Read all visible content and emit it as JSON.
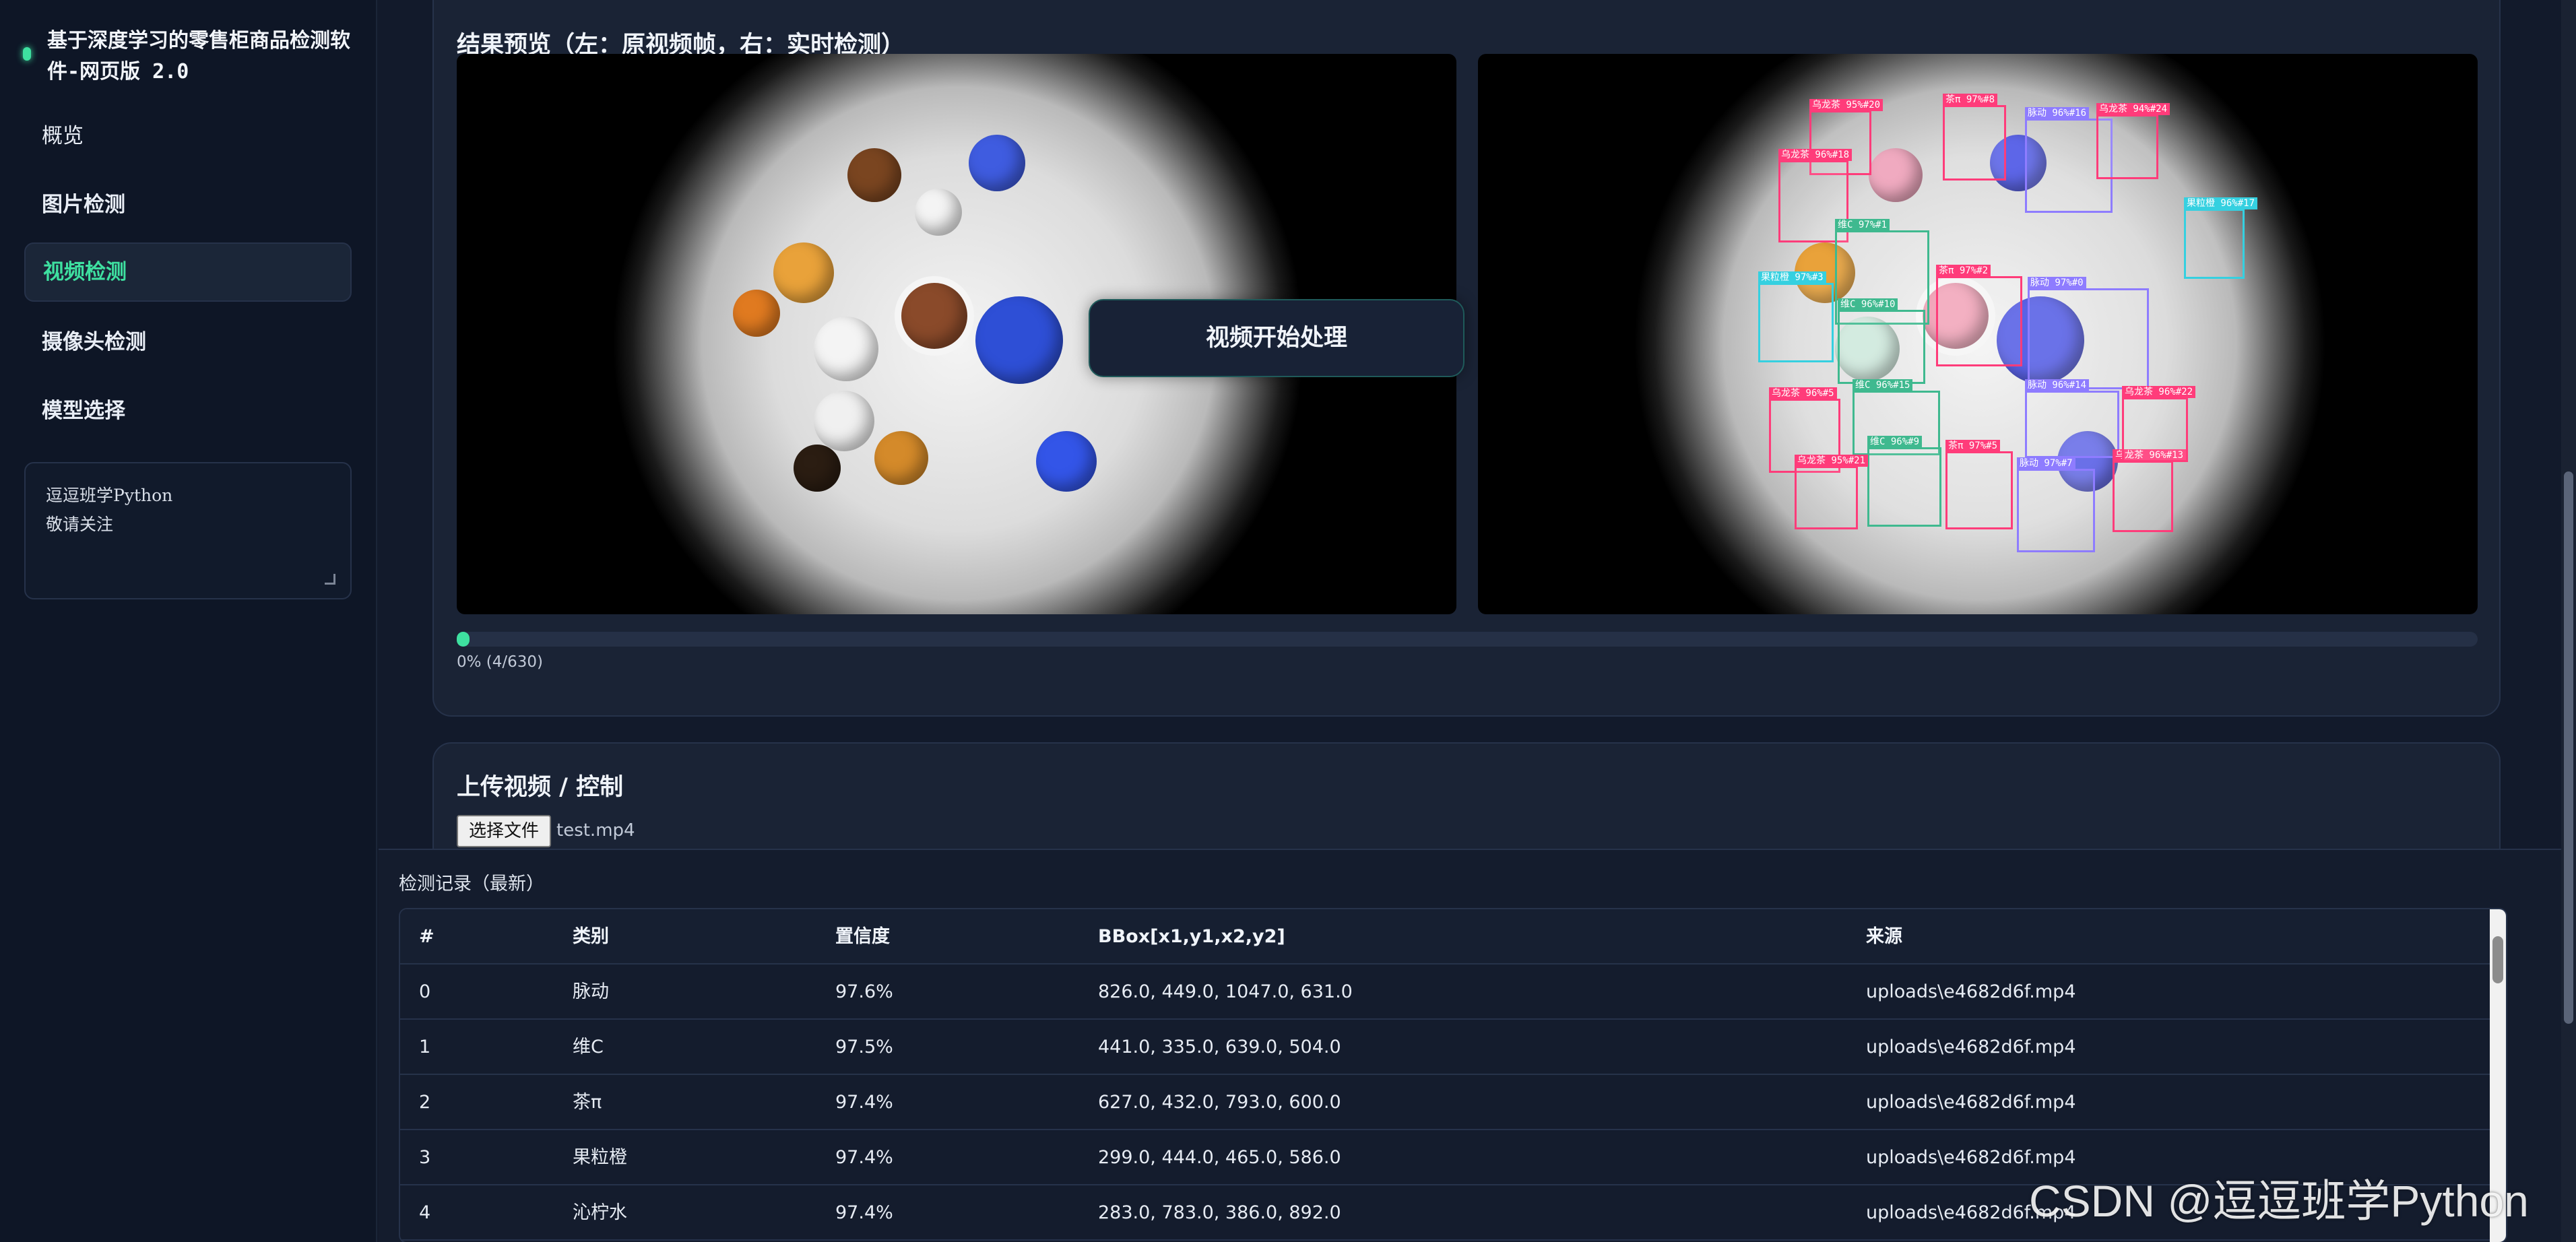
{
  "sidebar": {
    "brand_title": "基于深度学习的零售柜商品检测软件-网页版 2.0",
    "items": [
      {
        "label": "概览"
      },
      {
        "label": "图片检测"
      },
      {
        "label": "视频检测"
      },
      {
        "label": "摄像头检测"
      },
      {
        "label": "模型选择"
      }
    ],
    "active_item": "视频检测",
    "notes_text": "逗逗班学Python\n敬请关注"
  },
  "preview": {
    "title": "结果预览（左：原视频帧，右：实时检测）",
    "toast": "视频开始处理",
    "progress_value": 0.0063,
    "progress_text": "0% (4/630)",
    "detections": [
      {
        "label": "乌龙茶 95%#20",
        "color": "#ff3c7a"
      },
      {
        "label": "茶π 97%#8",
        "color": "#ff3c7a"
      },
      {
        "label": "脉动 96%#16",
        "color": "#8e7cff"
      },
      {
        "label": "乌龙茶 94%#24",
        "color": "#ff3c7a"
      },
      {
        "label": "乌龙茶 96%#18",
        "color": "#ff3c7a"
      },
      {
        "label": "果粒橙 96%#17",
        "color": "#35d0e0"
      },
      {
        "label": "维C 97%#1",
        "color": "#3fb98f"
      },
      {
        "label": "果粒橙 97%#3",
        "color": "#35d0e0"
      },
      {
        "label": "茶π 97%#2",
        "color": "#ff3c7a"
      },
      {
        "label": "脉动 97%#0",
        "color": "#8e7cff"
      },
      {
        "label": "维C 96%#10",
        "color": "#3fb98f"
      },
      {
        "label": "维C 96%#15",
        "color": "#3fb98f"
      },
      {
        "label": "脉动 96%#14",
        "color": "#8e7cff"
      },
      {
        "label": "乌龙茶 96%#5",
        "color": "#ff3c7a"
      },
      {
        "label": "维C 96%#9",
        "color": "#3fb98f"
      },
      {
        "label": "茶π 97%#5",
        "color": "#ff3c7a"
      },
      {
        "label": "乌龙茶 95%#21",
        "color": "#ff3c7a"
      },
      {
        "label": "脉动 97%#7",
        "color": "#8e7cff"
      },
      {
        "label": "乌龙茶 96%#13",
        "color": "#ff3c7a"
      },
      {
        "label": "乌龙茶 96%#22",
        "color": "#ff3c7a"
      }
    ]
  },
  "upload": {
    "title": "上传视频 / 控制",
    "file_button": "选择文件",
    "file_name": "test.mp4"
  },
  "records": {
    "title": "检测记录（最新）",
    "headers": [
      "#",
      "类别",
      "置信度",
      "BBox[x1,y1,x2,y2]",
      "来源"
    ],
    "rows": [
      [
        "0",
        "脉动",
        "97.6%",
        "826.0, 449.0, 1047.0, 631.0",
        "uploads\\e4682d6f.mp4"
      ],
      [
        "1",
        "维C",
        "97.5%",
        "441.0, 335.0, 639.0, 504.0",
        "uploads\\e4682d6f.mp4"
      ],
      [
        "2",
        "茶π",
        "97.4%",
        "627.0, 432.0, 793.0, 600.0",
        "uploads\\e4682d6f.mp4"
      ],
      [
        "3",
        "果粒橙",
        "97.4%",
        "299.0, 444.0, 465.0, 586.0",
        "uploads\\e4682d6f.mp4"
      ],
      [
        "4",
        "沁柠水",
        "97.4%",
        "283.0, 783.0, 386.0, 892.0",
        "uploads\\e4682d6f.mp4"
      ]
    ]
  },
  "watermark": "CSDN @逗逗班学Python"
}
